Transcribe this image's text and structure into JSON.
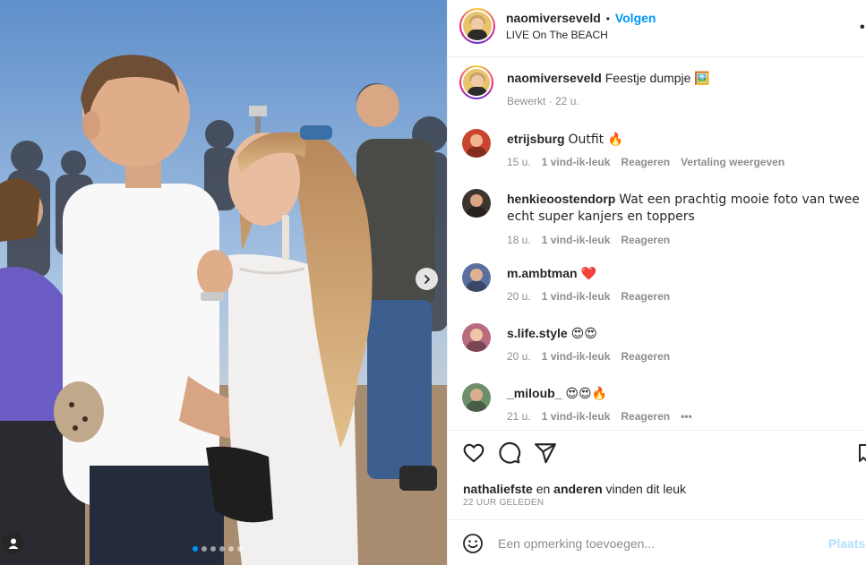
{
  "post": {
    "username": "naomiverseveld",
    "separator": "•",
    "follow_label": "Volgen",
    "location": "LIVE On The BEACH",
    "more_label": "•••",
    "caption_text": "Feestje dumpje 🖼️",
    "caption_meta": "Bewerkt · 22 u.",
    "carousel": {
      "slide_count": 6,
      "active_index": 0
    }
  },
  "comments": [
    {
      "username": "etrijsburg",
      "text": "Outfit 🔥",
      "time": "15 u.",
      "likes": "1 vind-ik-leuk",
      "reply": "Reageren",
      "extra": "Vertaling weergeven"
    },
    {
      "username": "henkieoostendorp",
      "text": "Wat een prachtig mooie foto van twee echt super kanjers en toppers",
      "time": "18 u.",
      "likes": "1 vind-ik-leuk",
      "reply": "Reageren",
      "extra": ""
    },
    {
      "username": "m.ambtman",
      "text": "❤️",
      "time": "20 u.",
      "likes": "1 vind-ik-leuk",
      "reply": "Reageren",
      "extra": ""
    },
    {
      "username": "s.life.style",
      "text": "😍😍",
      "time": "20 u.",
      "likes": "1 vind-ik-leuk",
      "reply": "Reageren",
      "extra": ""
    },
    {
      "username": "_miloub_",
      "text": "😍😍🔥",
      "time": "21 u.",
      "likes": "1 vind-ik-leuk",
      "reply": "Reageren",
      "extra": "•••"
    }
  ],
  "likes": {
    "first_user": "nathaliefste",
    "connector": "en",
    "others": "anderen",
    "suffix": "vinden dit leuk",
    "posted": "22 UUR GELEDEN"
  },
  "add_comment": {
    "placeholder": "Een opmerking toevoegen...",
    "post_label": "Plaatsen"
  },
  "icons": {
    "like": "heart-outline-icon",
    "comment": "comment-bubble-icon",
    "share": "paper-plane-icon",
    "save": "bookmark-icon",
    "emoji": "smiley-icon",
    "next": "chevron-right-icon",
    "tagged": "user-silhouette-icon"
  },
  "colors": {
    "accent": "#0095f6",
    "muted": "#8e8e8e",
    "post_disabled": "#b2dffc",
    "heart": "#ed4956"
  }
}
